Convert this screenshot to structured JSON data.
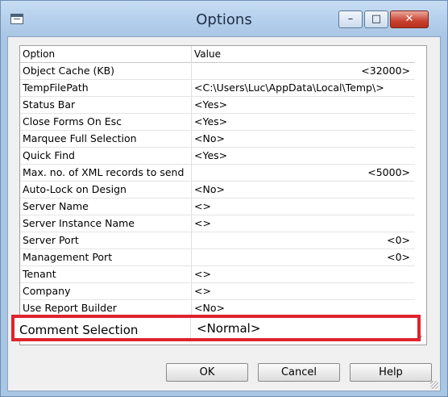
{
  "window": {
    "title": "Options"
  },
  "caption_buttons": {
    "minimize": "–",
    "maximize": "□",
    "close": "✕"
  },
  "grid": {
    "headers": {
      "option": "Option",
      "value": "Value"
    },
    "rows": [
      {
        "option": "Object Cache (KB)",
        "value": "<32000>",
        "align": "right"
      },
      {
        "option": "TempFilePath",
        "value": "<C:\\Users\\Luc\\AppData\\Local\\Temp\\>",
        "align": "left"
      },
      {
        "option": "Status Bar",
        "value": "<Yes>",
        "align": "left"
      },
      {
        "option": "Close Forms On Esc",
        "value": "<Yes>",
        "align": "left"
      },
      {
        "option": "Marquee Full Selection",
        "value": "<No>",
        "align": "left"
      },
      {
        "option": "Quick Find",
        "value": "<Yes>",
        "align": "left"
      },
      {
        "option": "Max. no. of XML records to send",
        "value": "<5000>",
        "align": "right"
      },
      {
        "option": "Auto-Lock on Design",
        "value": "<No>",
        "align": "left"
      },
      {
        "option": "Server Name",
        "value": "<>",
        "align": "left"
      },
      {
        "option": "Server Instance Name",
        "value": "<>",
        "align": "left"
      },
      {
        "option": "Server Port",
        "value": "<0>",
        "align": "right"
      },
      {
        "option": "Management Port",
        "value": "<0>",
        "align": "right"
      },
      {
        "option": "Tenant",
        "value": "<>",
        "align": "left"
      },
      {
        "option": "Company",
        "value": "<>",
        "align": "left"
      },
      {
        "option": "Use Report Builder",
        "value": "<No>",
        "align": "left"
      }
    ],
    "highlighted_row": {
      "option": "Comment Selection",
      "value": "<Normal>"
    }
  },
  "buttons": {
    "ok": "OK",
    "cancel": "Cancel",
    "help": "Help"
  },
  "colors": {
    "highlight_border": "#e0232d",
    "close_button": "#c9402e"
  }
}
